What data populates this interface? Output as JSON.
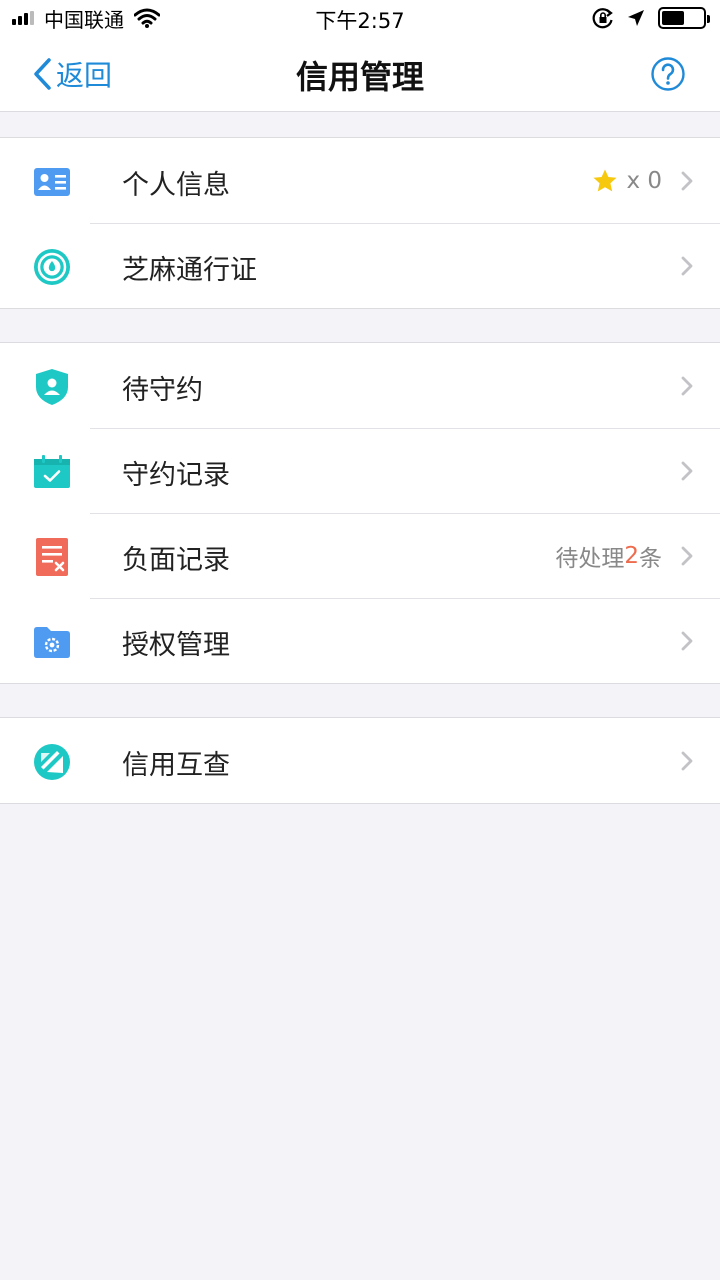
{
  "status_bar": {
    "carrier": "中国联通",
    "time": "下午2:57",
    "battery_level": 0.55
  },
  "nav": {
    "back_label": "返回",
    "title": "信用管理"
  },
  "colors": {
    "accent": "#1f8ad8",
    "teal": "#1ec8c4",
    "blue_icon": "#4f9bf2",
    "red_icon": "#f06b5a",
    "highlight": "#ef6b4d",
    "star": "#f6c90e"
  },
  "groups": [
    {
      "items": [
        {
          "label": "个人信息",
          "icon": "id-card-icon",
          "star_count": "x 0"
        },
        {
          "label": "芝麻通行证",
          "icon": "zhima-pass-icon"
        }
      ]
    },
    {
      "items": [
        {
          "label": "待守约",
          "icon": "shield-user-icon"
        },
        {
          "label": "守约记录",
          "icon": "calendar-check-icon"
        },
        {
          "label": "负面记录",
          "icon": "document-x-icon",
          "status_prefix": "待处理",
          "status_count": "2",
          "status_suffix": "条"
        },
        {
          "label": "授权管理",
          "icon": "folder-gear-icon"
        }
      ]
    },
    {
      "items": [
        {
          "label": "信用互查",
          "icon": "mutual-check-icon"
        }
      ]
    }
  ]
}
